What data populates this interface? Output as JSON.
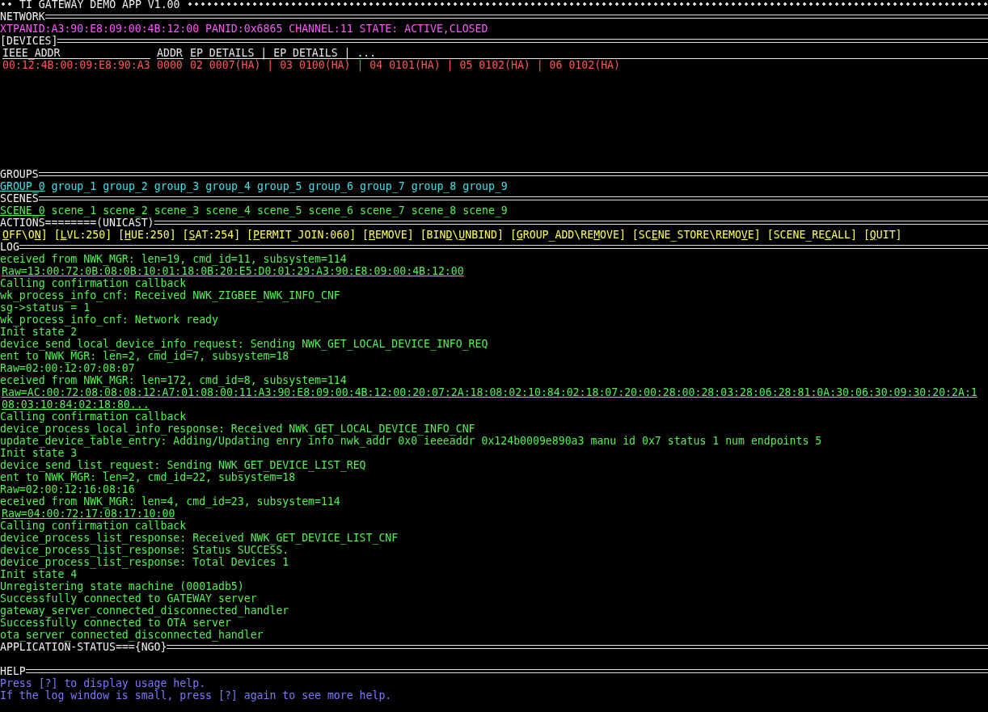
{
  "title": "TI GATEWAY DEMO APP V1.00",
  "network": {
    "header": "NETWORK",
    "info": "XTPANID:A3:90:E8:09:00:4B:12:00 PANID:0x6865 CHANNEL:11 STATE: ACTIVE,CLOSED"
  },
  "devices": {
    "header": "[DEVICES]",
    "columns": [
      "IEEE_ADDR",
      "ADDR",
      "EP DETAILS | EP DETAILS | ..."
    ],
    "rows": [
      [
        "00:12:4B:00:09:E8:90:A3",
        "0000",
        "02 0007(HA) | 03 0100(HA) | 04 0101(HA) | 05 0102(HA) | 06 0102(HA)"
      ]
    ]
  },
  "groups": {
    "header": "GROUPS",
    "items": [
      {
        "label": "GROUP_0",
        "selected": true
      },
      {
        "label": "group_1",
        "selected": false
      },
      {
        "label": "group_2",
        "selected": false
      },
      {
        "label": "group_3",
        "selected": false
      },
      {
        "label": "group_4",
        "selected": false
      },
      {
        "label": "group_5",
        "selected": false
      },
      {
        "label": "group_6",
        "selected": false
      },
      {
        "label": "group_7",
        "selected": false
      },
      {
        "label": "group_8",
        "selected": false
      },
      {
        "label": "group_9",
        "selected": false
      }
    ]
  },
  "scenes": {
    "header": "SCENES",
    "items": [
      {
        "label": "SCENE_0",
        "selected": true
      },
      {
        "label": "scene_1",
        "selected": false
      },
      {
        "label": "scene_2",
        "selected": false
      },
      {
        "label": "scene_3",
        "selected": false
      },
      {
        "label": "scene_4",
        "selected": false
      },
      {
        "label": "scene_5",
        "selected": false
      },
      {
        "label": "scene_6",
        "selected": false
      },
      {
        "label": "scene_7",
        "selected": false
      },
      {
        "label": "scene_8",
        "selected": false
      },
      {
        "label": "scene_9",
        "selected": false
      }
    ]
  },
  "actions": {
    "header": "ACTIONS========(UNICAST)",
    "items": [
      {
        "segments": [
          {
            "text": "O",
            "hotkey": true
          },
          {
            "text": "FF\\O",
            "hotkey": false
          },
          {
            "text": "N",
            "hotkey": true
          },
          {
            "text": "]",
            "hotkey": false
          }
        ]
      },
      {
        "segments": [
          {
            "text": "[",
            "hotkey": false
          },
          {
            "text": "L",
            "hotkey": true
          },
          {
            "text": "VL:250]",
            "hotkey": false
          }
        ]
      },
      {
        "segments": [
          {
            "text": "[",
            "hotkey": false
          },
          {
            "text": "H",
            "hotkey": true
          },
          {
            "text": "UE:250]",
            "hotkey": false
          }
        ]
      },
      {
        "segments": [
          {
            "text": "[",
            "hotkey": false
          },
          {
            "text": "S",
            "hotkey": true
          },
          {
            "text": "AT:254]",
            "hotkey": false
          }
        ]
      },
      {
        "segments": [
          {
            "text": "[",
            "hotkey": false
          },
          {
            "text": "P",
            "hotkey": true
          },
          {
            "text": "ERMIT_JOIN:060]",
            "hotkey": false
          }
        ]
      },
      {
        "segments": [
          {
            "text": "[",
            "hotkey": false
          },
          {
            "text": "R",
            "hotkey": true
          },
          {
            "text": "EMOVE]",
            "hotkey": false
          }
        ]
      },
      {
        "segments": [
          {
            "text": "[BIN",
            "hotkey": false
          },
          {
            "text": "D",
            "hotkey": true
          },
          {
            "text": "\\",
            "hotkey": false
          },
          {
            "text": "U",
            "hotkey": true
          },
          {
            "text": "NBIND]",
            "hotkey": false
          }
        ]
      },
      {
        "segments": [
          {
            "text": "[",
            "hotkey": false
          },
          {
            "text": "G",
            "hotkey": true
          },
          {
            "text": "ROUP_ADD\\RE",
            "hotkey": false
          },
          {
            "text": "M",
            "hotkey": true
          },
          {
            "text": "OVE]",
            "hotkey": false
          }
        ]
      },
      {
        "segments": [
          {
            "text": "[SC",
            "hotkey": false
          },
          {
            "text": "E",
            "hotkey": true
          },
          {
            "text": "NE_STORE\\REMO",
            "hotkey": false
          },
          {
            "text": "V",
            "hotkey": true
          },
          {
            "text": "E]",
            "hotkey": false
          }
        ]
      },
      {
        "segments": [
          {
            "text": "[SCENE_RE",
            "hotkey": false
          },
          {
            "text": "C",
            "hotkey": true
          },
          {
            "text": "ALL]",
            "hotkey": false
          }
        ]
      },
      {
        "segments": [
          {
            "text": "[",
            "hotkey": false
          },
          {
            "text": "Q",
            "hotkey": true
          },
          {
            "text": "UIT]",
            "hotkey": false
          }
        ]
      }
    ]
  },
  "log": {
    "header": "LOG",
    "lines": [
      {
        "text": "eceived from NWK_MGR: len=19, cmd_id=11, subsystem=114",
        "underlined": false
      },
      {
        "text": "Raw=13:00:72:0B:08:0B:10:01:18:0B:20:E5:D0:01:29:A3:90:E8:09:00:4B:12:00",
        "underlined": true
      },
      {
        "text": "Calling confirmation callback",
        "underlined": false
      },
      {
        "text": "wk_process_info_cnf: Received NWK_ZIGBEE_NWK_INFO_CNF",
        "underlined": false
      },
      {
        "text": "sg->status = 1",
        "underlined": false
      },
      {
        "text": "wk_process_info_cnf: Network ready",
        "underlined": false
      },
      {
        "text": "Init state 2",
        "underlined": false
      },
      {
        "text": "device_send_local_device_info_request: Sending NWK_GET_LOCAL_DEVICE_INFO_REQ",
        "underlined": false
      },
      {
        "text": "ent to NWK_MGR: len=2, cmd_id=7, subsystem=18",
        "underlined": false
      },
      {
        "text": "Raw=02:00:12:07:08:07",
        "underlined": false
      },
      {
        "text": "eceived from NWK_MGR: len=172, cmd_id=8, subsystem=114",
        "underlined": false
      },
      {
        "text": "Raw=AC:00:72:08:08:08:12:A7:01:08:00:11:A3:90:E8:09:00:4B:12:00:20:07:2A:18:08:02:10:84:02:18:07:20:00:28:00:28:03:28:06:28:81:0A:30:06:30:09:30:20:2A:1",
        "underlined": true
      },
      {
        "text": "08:03:10:84:02:18:80...",
        "underlined": true
      },
      {
        "text": "Calling confirmation callback",
        "underlined": false
      },
      {
        "text": "device_process_local_info_response: Received NWK_GET_LOCAL_DEVICE_INFO_CNF",
        "underlined": false
      },
      {
        "text": "update_device_table_entry: Adding/Updating enry info nwk_addr 0x0 ieeeaddr 0x124b0009e890a3 manu id 0x7 status 1 num endpoints 5",
        "underlined": false
      },
      {
        "text": "Init state 3",
        "underlined": false
      },
      {
        "text": "device_send_list_request: Sending NWK_GET_DEVICE_LIST_REQ",
        "underlined": false
      },
      {
        "text": "ent to NWK_MGR: len=2, cmd_id=22, subsystem=18",
        "underlined": false
      },
      {
        "text": "Raw=02:00:12:16:08:16",
        "underlined": false
      },
      {
        "text": "eceived from NWK_MGR: len=4, cmd_id=23, subsystem=114",
        "underlined": false
      },
      {
        "text": "Raw=04:00:72:17:08:17:10:00",
        "underlined": true
      },
      {
        "text": "Calling confirmation callback",
        "underlined": false
      },
      {
        "text": "device_process_list_response: Received NWK_GET_DEVICE_LIST_CNF",
        "underlined": false
      },
      {
        "text": "device_process_list_response: Status SUCCESS.",
        "underlined": false
      },
      {
        "text": "device_process_list_response: Total Devices 1",
        "underlined": false
      },
      {
        "text": "Init state 4",
        "underlined": false
      },
      {
        "text": "Unregistering state machine (0001adb5)",
        "underlined": false
      },
      {
        "text": "Successfully connected to GATEWAY server",
        "underlined": false
      },
      {
        "text": "gateway_server_connected_disconnected_handler",
        "underlined": false
      },
      {
        "text": "Successfully connected to OTA server",
        "underlined": false
      },
      {
        "text": "ota_server_connected_disconnected_handler",
        "underlined": false
      }
    ]
  },
  "application_status": {
    "header": "APPLICATION-STATUS==={NGO}"
  },
  "help": {
    "header": "HELP",
    "lines": [
      "Press [?] to display usage help.",
      "If the log window is small, press [?] again to see more help."
    ]
  }
}
